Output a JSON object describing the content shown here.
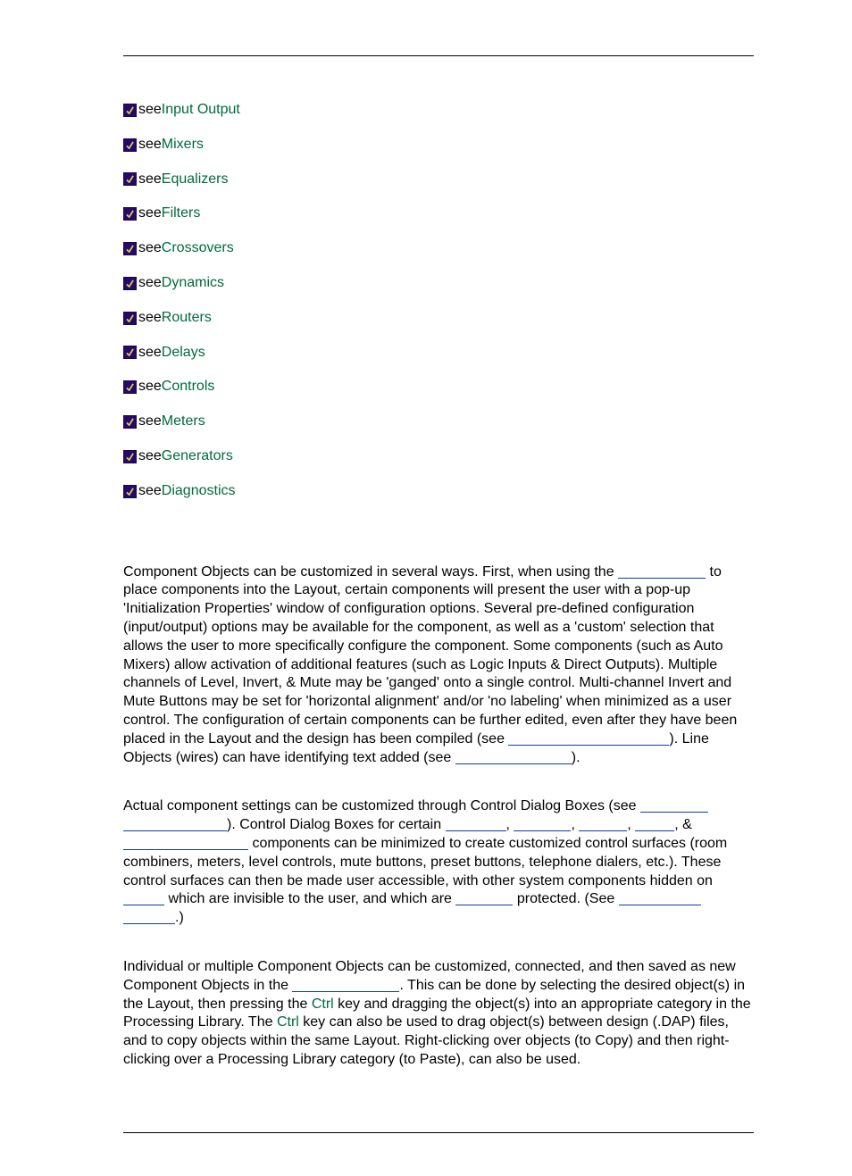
{
  "link_prefix": "see ",
  "links": [
    "Input Output",
    "Mixers",
    "Equalizers",
    "Filters",
    "Crossovers",
    "Dynamics",
    "Routers",
    "Delays",
    "Controls",
    "Meters",
    "Generators",
    "Diagnostics"
  ],
  "p1a": "Component Objects can be customized in several ways. First, when using the ",
  "p1b": " to place components into the Layout, certain components will present the user with a pop-up 'Initialization Properties' window of configuration options. Several pre-defined configuration (input/output) options may be available for the component, as well as a 'custom' selection that allows the user to more specifically configure the component. Some components (such as Auto Mixers) allow activation of additional features (such as Logic Inputs & Direct Outputs). Multiple channels of Level, Invert, & Mute may be 'ganged' onto a single control. Multi-channel Invert and Mute Buttons may be set for 'horizontal alignment' and/or 'no labeling' when minimized as a user control. The configuration of certain components can be further edited, even after they have been placed in the Layout and the design has been compiled (see ",
  "p1c": "). Line Objects (wires) can have identifying text added (see ",
  "p1d": ").",
  "p2a": "Actual component settings can be customized through Control Dialog Boxes (see ",
  "p2b": "). Control Dialog Boxes for certain ",
  "p2c": ", ",
  "p2d": ", ",
  "p2e": ", ",
  "p2f": ", & ",
  "p2g": " components can be minimized to create customized control surfaces (room combiners, meters, level controls, mute buttons, preset buttons, telephone dialers, etc.). These control surfaces can then be made user accessible, with other system components hidden on ",
  "p2h": " which are invisible to the user, and which are ",
  "p2i": " protected. (See ",
  "p2j": ".)",
  "p3a": "Individual or multiple Component Objects can be customized, connected, and then saved as new Component Objects in the ",
  "p3b": ". This can be done by selecting the desired object(s) in the Layout, then pressing the ",
  "p3mid1": "Ctrl",
  "p3c": " key and dragging the object(s) into an appropriate category in the Processing Library. The ",
  "p3mid2": "Ctrl",
  "p3d": " key can also be used to drag object(s) between design (.DAP) files, and to copy objects within the same Layout. Right-clicking over objects (to Copy) and then right-clicking over a Processing Library category (to Paste), can also be used."
}
